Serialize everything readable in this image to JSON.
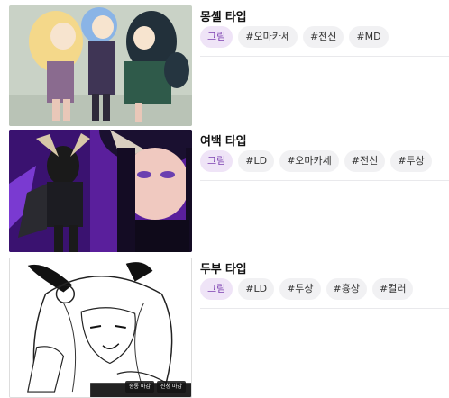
{
  "items": [
    {
      "title": "몽셸 타입",
      "tags": [
        "그림",
        "#오마카세",
        "#전신",
        "#MD"
      ]
    },
    {
      "title": "여백 타입",
      "tags": [
        "그림",
        "#LD",
        "#오마카세",
        "#전신",
        "#두상"
      ]
    },
    {
      "title": "두부 타입",
      "tags": [
        "그림",
        "#LD",
        "#두상",
        "#흉상",
        "#컬러"
      ],
      "badges": [
        "송통 마감",
        "신청 마감"
      ]
    }
  ]
}
